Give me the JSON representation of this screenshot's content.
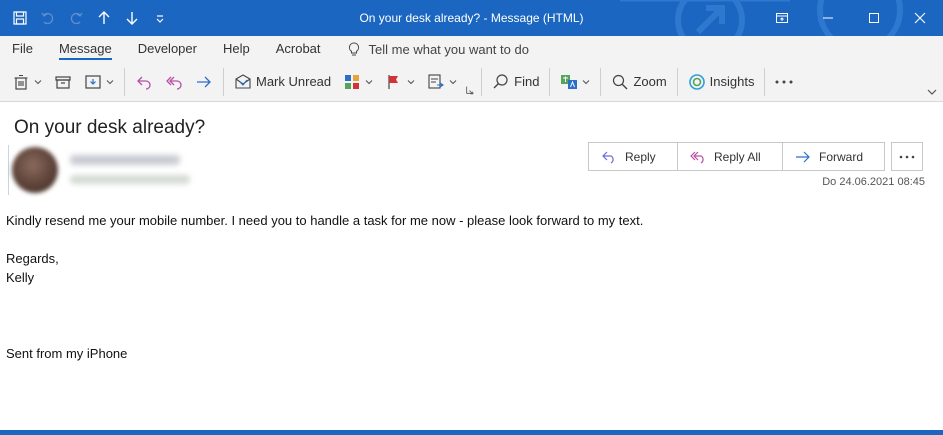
{
  "window": {
    "title": "On your desk already?  -  Message (HTML)"
  },
  "quick_access": [
    "save-icon",
    "undo-icon",
    "redo-icon",
    "up-arrow-icon",
    "down-arrow-icon",
    "customize-icon"
  ],
  "menu": {
    "tabs": [
      "File",
      "Message",
      "Developer",
      "Help",
      "Acrobat"
    ],
    "active_tab": "Message",
    "tell_me": "Tell me what you want to do"
  },
  "ribbon": {
    "mark_unread": "Mark Unread",
    "find": "Find",
    "zoom": "Zoom",
    "insights": "Insights"
  },
  "message": {
    "subject": "On your desk already?",
    "actions": {
      "reply": "Reply",
      "reply_all": "Reply All",
      "forward": "Forward"
    },
    "datetime": "Do 24.06.2021 08:45",
    "body": {
      "line1": "Kindly resend me your mobile number. I need you to handle a task for me now - please look forward to my text.",
      "line2": "Regards,",
      "line3": "Kelly",
      "line4": "Sent from my iPhone"
    }
  },
  "colors": {
    "titlebar": "#1b66c0",
    "reply_arrow": "#6b6bd6",
    "reply_all_arrow": "#b84fa8",
    "forward_arrow": "#2b6fc9",
    "flag": "#d13438"
  }
}
